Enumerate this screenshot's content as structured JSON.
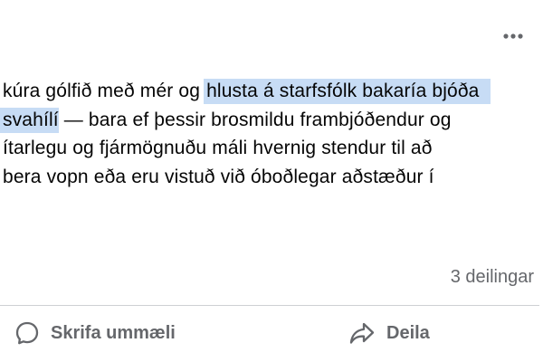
{
  "post": {
    "lines": [
      {
        "before": "kúra gólfið með mér og ",
        "highlight": "hlusta á starfsfólk bakaría bjóða",
        "after": ""
      },
      {
        "before": "",
        "highlight": "svahílí",
        "after": " — bara ef þessir brosmildu frambjóðendur og"
      },
      {
        "before": "ítarlegu og fjármögnuðu máli hvernig stendur til að",
        "highlight": "",
        "after": ""
      },
      {
        "before": "bera vopn eða eru vistuð við óboðlegar aðstæður í",
        "highlight": "",
        "after": ""
      }
    ],
    "highlight_color": "#c7dcf5"
  },
  "stats": {
    "shares_label": "3 deilingar"
  },
  "actions": {
    "comment_label": "Skrifa ummæli",
    "share_label": "Deila"
  },
  "icons": {
    "more": "more-horizontal-icon",
    "comment": "comment-bubble-icon",
    "share": "share-arrow-icon"
  },
  "colors": {
    "secondary_text": "#65676b",
    "divider": "#ced0d4"
  }
}
